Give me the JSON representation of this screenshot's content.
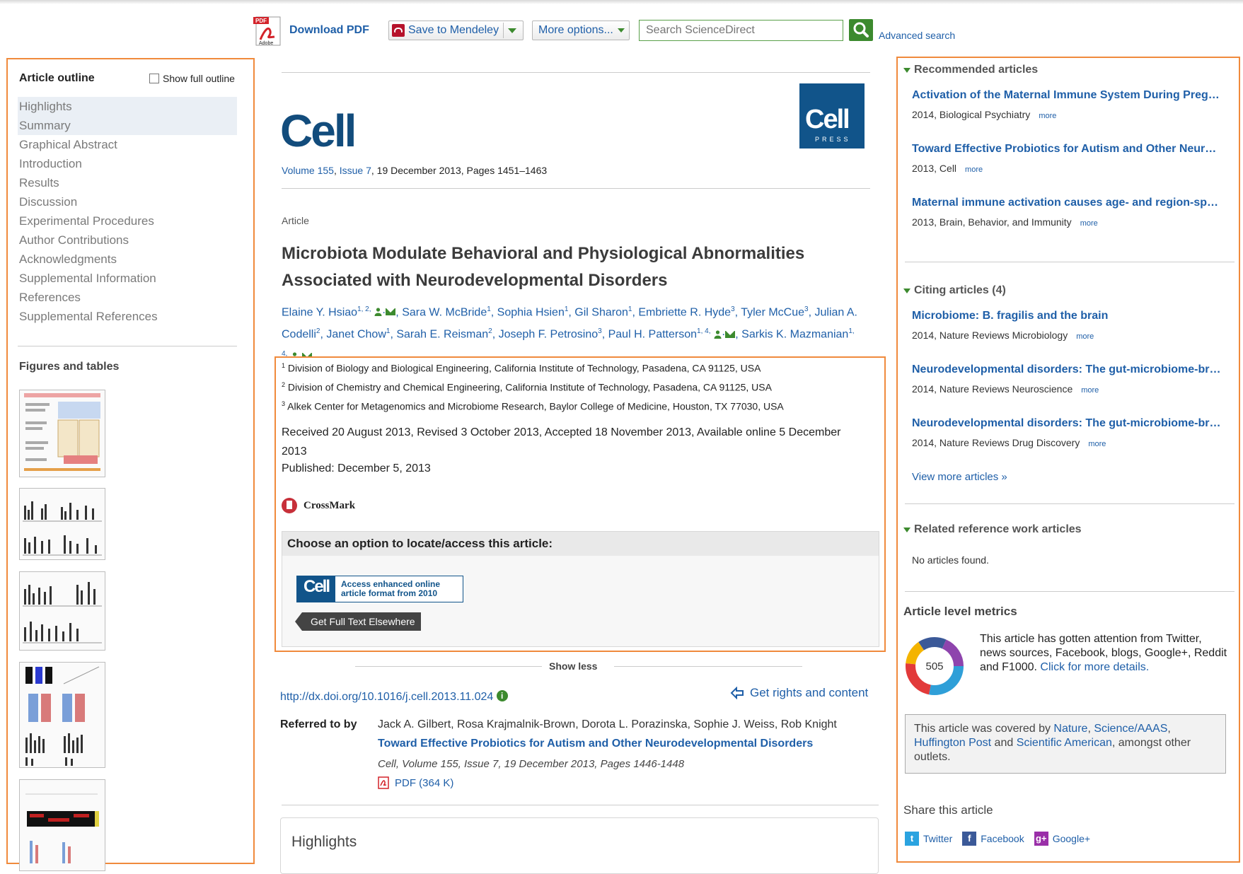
{
  "toolbar": {
    "download_pdf": "Download PDF",
    "pdf_icon_top": "PDF",
    "pdf_icon_bottom": "Adobe",
    "save_mendeley": "Save to Mendeley",
    "more_options": "More options...",
    "search_placeholder": "Search ScienceDirect",
    "advanced_search": "Advanced search"
  },
  "outline": {
    "title": "Article outline",
    "show_full": "Show full outline",
    "items": [
      {
        "label": "Highlights"
      },
      {
        "label": "Summary"
      },
      {
        "label": "Graphical Abstract"
      },
      {
        "label": "Introduction"
      },
      {
        "label": "Results"
      },
      {
        "label": "Discussion"
      },
      {
        "label": "Experimental Procedures"
      },
      {
        "label": "Author Contributions"
      },
      {
        "label": "Acknowledgments"
      },
      {
        "label": "Supplemental Information"
      },
      {
        "label": "References"
      },
      {
        "label": "Supplemental References"
      }
    ],
    "figures_title": "Figures and tables"
  },
  "article": {
    "journal": "Cell",
    "press_logo_main": "Cell",
    "press_logo_sub": "PRESS",
    "volume": "Volume 155",
    "issue": "Issue 7",
    "date_pages": ", 19 December 2013, Pages 1451–1463",
    "type": "Article",
    "title": "Microbiota Modulate Behavioral and Physiological Abnormalities Associated with Neurodevelopmental Disorders",
    "authors": {
      "a1": "Elaine Y. Hsiao",
      "a1_sup": "1, 2,",
      "a2": "Sara W. McBride",
      "a2_sup": "1",
      "a3": "Sophia Hsien",
      "a3_sup": "1",
      "a4": "Gil Sharon",
      "a4_sup": "1",
      "a5": "Embriette R. Hyde",
      "a5_sup": "3",
      "a6": "Tyler McCue",
      "a6_sup": "3",
      "a7": "Julian A. Codelli",
      "a7_sup": "2",
      "a8": "Janet Chow",
      "a8_sup": "1",
      "a9": "Sarah E. Reisman",
      "a9_sup": "2",
      "a10": "Joseph F. Petrosino",
      "a10_sup": "3",
      "a11": "Paul H. Patterson",
      "a11_sup": "1, 4,",
      "a12": "Sarkis K. Mazmanian",
      "a12_sup": "1, 4,"
    },
    "affiliations": [
      {
        "num": "1",
        "text": "Division of Biology and Biological Engineering, California Institute of Technology, Pasadena, CA 91125, USA"
      },
      {
        "num": "2",
        "text": "Division of Chemistry and Chemical Engineering, California Institute of Technology, Pasadena, CA 91125, USA"
      },
      {
        "num": "3",
        "text": "Alkek Center for Metagenomics and Microbiome Research, Baylor College of Medicine, Houston, TX 77030, USA"
      }
    ],
    "dates": "Received 20 August 2013, Revised 3 October 2013, Accepted 18 November 2013, Available online 5 December 2013",
    "published": "Published: December 5, 2013",
    "crossmark": "CrossMark",
    "access": {
      "heading": "Choose an option to locate/access this article:",
      "enhanced_logo": "Cell",
      "enhanced_line1": "Access enhanced online",
      "enhanced_line2": "article format from 2010",
      "full_text": "Get Full Text Elsewhere"
    },
    "show_less": "Show less",
    "doi": "http://dx.doi.org/10.1016/j.cell.2013.11.024",
    "rights": "Get rights and content",
    "referred": {
      "label": "Referred to by",
      "authors": "Jack A. Gilbert, Rosa Krajmalnik-Brown, Dorota L. Porazinska, Sophie J. Weiss, Rob Knight",
      "title": "Toward Effective Probiotics for Autism and Other Neurodevelopmental Disorders",
      "citation": "Cell, Volume 155, Issue 7, 19 December 2013, Pages 1446-1448",
      "pdf": "PDF (364 K)"
    },
    "highlights_heading": "Highlights"
  },
  "sidebar": {
    "recommended_head": "Recommended articles",
    "recommended": [
      {
        "title": "Activation of the Maternal Immune System During Pregnancy Alters Behavioral Development",
        "meta": "2014, Biological Psychiatry",
        "more": "more"
      },
      {
        "title": "Toward Effective Probiotics for Autism and Other Neurodevelopmental Disorders",
        "meta": "2013, Cell",
        "more": "more"
      },
      {
        "title": "Maternal immune activation causes age- and region-specific changes",
        "meta": "2013, Brain, Behavior, and Immunity",
        "more": "more"
      }
    ],
    "citing_head": "Citing articles (4)",
    "citing": [
      {
        "title": "Microbiome: B. fragilis and the brain",
        "meta": "2014, Nature Reviews Microbiology",
        "more": "more"
      },
      {
        "title": "Neurodevelopmental disorders: The gut-microbiome-brain connection",
        "meta": "2014, Nature Reviews Neuroscience",
        "more": "more"
      },
      {
        "title": "Neurodevelopmental disorders: The gut-microbiome-brain connection",
        "meta": "2014, Nature Reviews Drug Discovery",
        "more": "more"
      }
    ],
    "view_more": "View more articles »",
    "related_head": "Related reference work articles",
    "no_articles": "No articles found.",
    "metrics_head": "Article level metrics",
    "altmetric_score": "505",
    "metrics_text": "This article has gotten attention from Twitter, news sources, Facebook, blogs, Google+, Reddit and F1000.",
    "metrics_link": "Click for more details.",
    "covered": {
      "prefix": "This article was covered by ",
      "s1": "Nature",
      "s2": "Science/AAAS",
      "s3": "Huffington Post",
      "and": " and ",
      "s4": "Scientific American",
      "suffix": ", amongst other outlets."
    },
    "share_head": "Share this article",
    "share": {
      "twitter": "Twitter",
      "facebook": "Facebook",
      "google": "Google+"
    }
  },
  "colors": {
    "highlight_border": "#f08a3c",
    "link": "#1f5fa8",
    "accent_green": "#3c8a2e",
    "cell_blue": "#11548a"
  }
}
